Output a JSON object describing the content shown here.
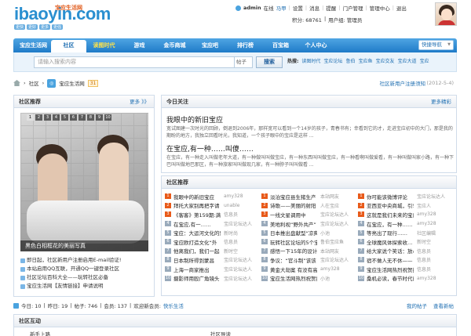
{
  "brand": {
    "logo_text": "ibaoyin.com",
    "logo_sub": "宝应生活网",
    "logo_tags": [
      "更快",
      "更好",
      "更多",
      "更强"
    ]
  },
  "user": {
    "name": "admin",
    "status": "在线",
    "links": [
      "马甲",
      "设置",
      "消息",
      "提醒",
      "门户管理",
      "管理中心",
      "退出"
    ],
    "credits_label": "积分: 68761",
    "group_label": "用户组: 管理员"
  },
  "nav": {
    "items": [
      "宝应生活网",
      "社区",
      "读图时代",
      "游戏",
      "金币商城",
      "宝应吧",
      "排行榜",
      "百宝箱",
      "个人中心"
    ],
    "active_index": 1,
    "highlight_index": 2,
    "quick_nav": "快捷导航"
  },
  "search": {
    "placeholder": "请输入搜索内容",
    "type": "帖子",
    "button": "搜索",
    "hot_label": "热搜:",
    "hot_words": [
      "读图时代",
      "宝应论坛",
      "鲁伯",
      "宝应鱼",
      "宝应交友",
      "宝应大道",
      "宝应"
    ]
  },
  "breadcrumb": {
    "items": [
      "社区",
      "宝应生活网"
    ],
    "count": "31",
    "new_user_link": "社区新用户注册须知",
    "date": "(2012-5-4)"
  },
  "left": {
    "title": "社区推荐",
    "more": "更多 》》",
    "photo_nums": [
      "1",
      "2",
      "3",
      "4",
      "5",
      "6",
      "7",
      "8",
      "9",
      "10"
    ],
    "photo_caption": "黑色白相框花的美丽写真",
    "links": [
      "即日起，社区新用户注册启用E-mail验证!",
      "本站启用QQ互联，开通QQ一键登录社区",
      "社区论坛百科大全——玩转社区必备",
      "宝应生活网【友情链接】申请说明"
    ]
  },
  "today": {
    "title": "今日关注",
    "more": "更多精彩",
    "headline1": "我眼中的新旧宝应",
    "summary1": "宽试图建一次时光的回顾，倒退到2006年，那样宽可以看到一个14岁的孩子，青春书有；幸看到它的才，走进宝应初中的大门，那是我的期盼的地方，我独立回看时光，我知道，一个孩子眼中的宝应是这样 ...",
    "headline2": "在宝应,有一种……叫傻……",
    "summary2": "在宝应，有一种走入叫做老年大道，有一种做叫叫做宝应，有一种东西叫叫做宝应，有一种看啊叫做爱看，有一种叫做叫家小路，有一种下巴叫叫做地巴那区，有一种旅家叫叫做现几家，有一种脖子叫叫做看 ..."
  },
  "rec": {
    "title": "社区推荐",
    "columns": [
      [
        {
          "n": "1",
          "t": "我眼中的新旧宝应",
          "a": "amy328"
        },
        {
          "n": "2",
          "t": "拜托大家别再把字请",
          "a": "unable"
        },
        {
          "n": "3",
          "t": "《客客》第159期:满",
          "a": "信息员"
        },
        {
          "n": "4",
          "t": "在宝应,有一……",
          "a": "宝应论坛达人"
        },
        {
          "n": "5",
          "t": "宝应：大运河文化的魅",
          "a": "新时尚"
        },
        {
          "n": "6",
          "t": "宝应欧打造文化“外",
          "a": "信息员"
        },
        {
          "n": "7",
          "t": "他离我们，我们一起",
          "a": "新时空"
        },
        {
          "n": "8",
          "t": "日本制所得到蒙昌",
          "a": "宝应论坛达人"
        },
        {
          "n": "9",
          "t": "上海一商家推出",
          "a": "宝应论坛达人"
        },
        {
          "n": "10",
          "t": "摄影师用殴广角镜头",
          "a": "宝应论坛达人"
        }
      ],
      [
        {
          "n": "1",
          "t": "淡泊宝应县生猪生产",
          "a": "本站网友"
        },
        {
          "n": "2",
          "t": "诗歌——美丽的射阳",
          "a": "人在宝应"
        },
        {
          "n": "3",
          "t": "一线文星调用中",
          "a": "宝应论坛达人"
        },
        {
          "n": "4",
          "t": "美地利视“野外共产”",
          "a": "宝应论坛达人"
        },
        {
          "n": "5",
          "t": "日本推出盘献型“凉爽”",
          "a": "小池"
        },
        {
          "n": "6",
          "t": "玩转社区论坛的5个宝贝",
          "a": "鲁伯宝应鱼"
        },
        {
          "n": "7",
          "t": "感悟一下15年的设计",
          "a": "本站网友"
        },
        {
          "n": "8",
          "t": "争议：“官斗制”该该",
          "a": "宝应论坛达人"
        },
        {
          "n": "9",
          "t": "黄金大劫案 有没有高",
          "a": "amy328"
        },
        {
          "n": "10",
          "t": "宝应生活网热烈祝贺扬州",
          "a": "小池"
        }
      ],
      [
        {
          "n": "1",
          "t": "你可能该微博评论",
          "a": "宝应论坛达人"
        },
        {
          "n": "2",
          "t": "亚西亚中央商城，引领",
          "a": "宝应人"
        },
        {
          "n": "3",
          "t": "这就是我们未来的宝应",
          "a": "amy328"
        },
        {
          "n": "4",
          "t": "在宝应，有一种……",
          "a": "amy328"
        },
        {
          "n": "5",
          "t": "等亮出了现行……",
          "a": "社区编辑"
        },
        {
          "n": "6",
          "t": "全球魔风体探索收…",
          "a": "新时空"
        },
        {
          "n": "7",
          "t": "给大家说个笑话：放心",
          "a": "信息员"
        },
        {
          "n": "8",
          "t": "宿不做人无不休——",
          "a": "信息员"
        },
        {
          "n": "9",
          "t": "宝应生活网热烈祝贺扬州",
          "a": "信息员"
        },
        {
          "n": "10",
          "t": "桑机必读，春节时代的美",
          "a": "amy328"
        }
      ]
    ]
  },
  "stats": {
    "today": "今日: 10",
    "yesterday": "昨日: 19",
    "posts": "帖子: 746",
    "members": "会员: 137",
    "newest_label": "欢迎新会员:",
    "newest": "快乐生活",
    "my_posts": "我的帖子",
    "new_posts": "查看新帖"
  },
  "interact": {
    "title": "社区互动",
    "items": [
      "新手上路",
      "社区导读"
    ]
  },
  "colors": {
    "nav_top": "#4fa5e3",
    "nav_bottom": "#1f7bc8",
    "link": "#1f6fb2",
    "rank_top": "#e85a1a"
  }
}
